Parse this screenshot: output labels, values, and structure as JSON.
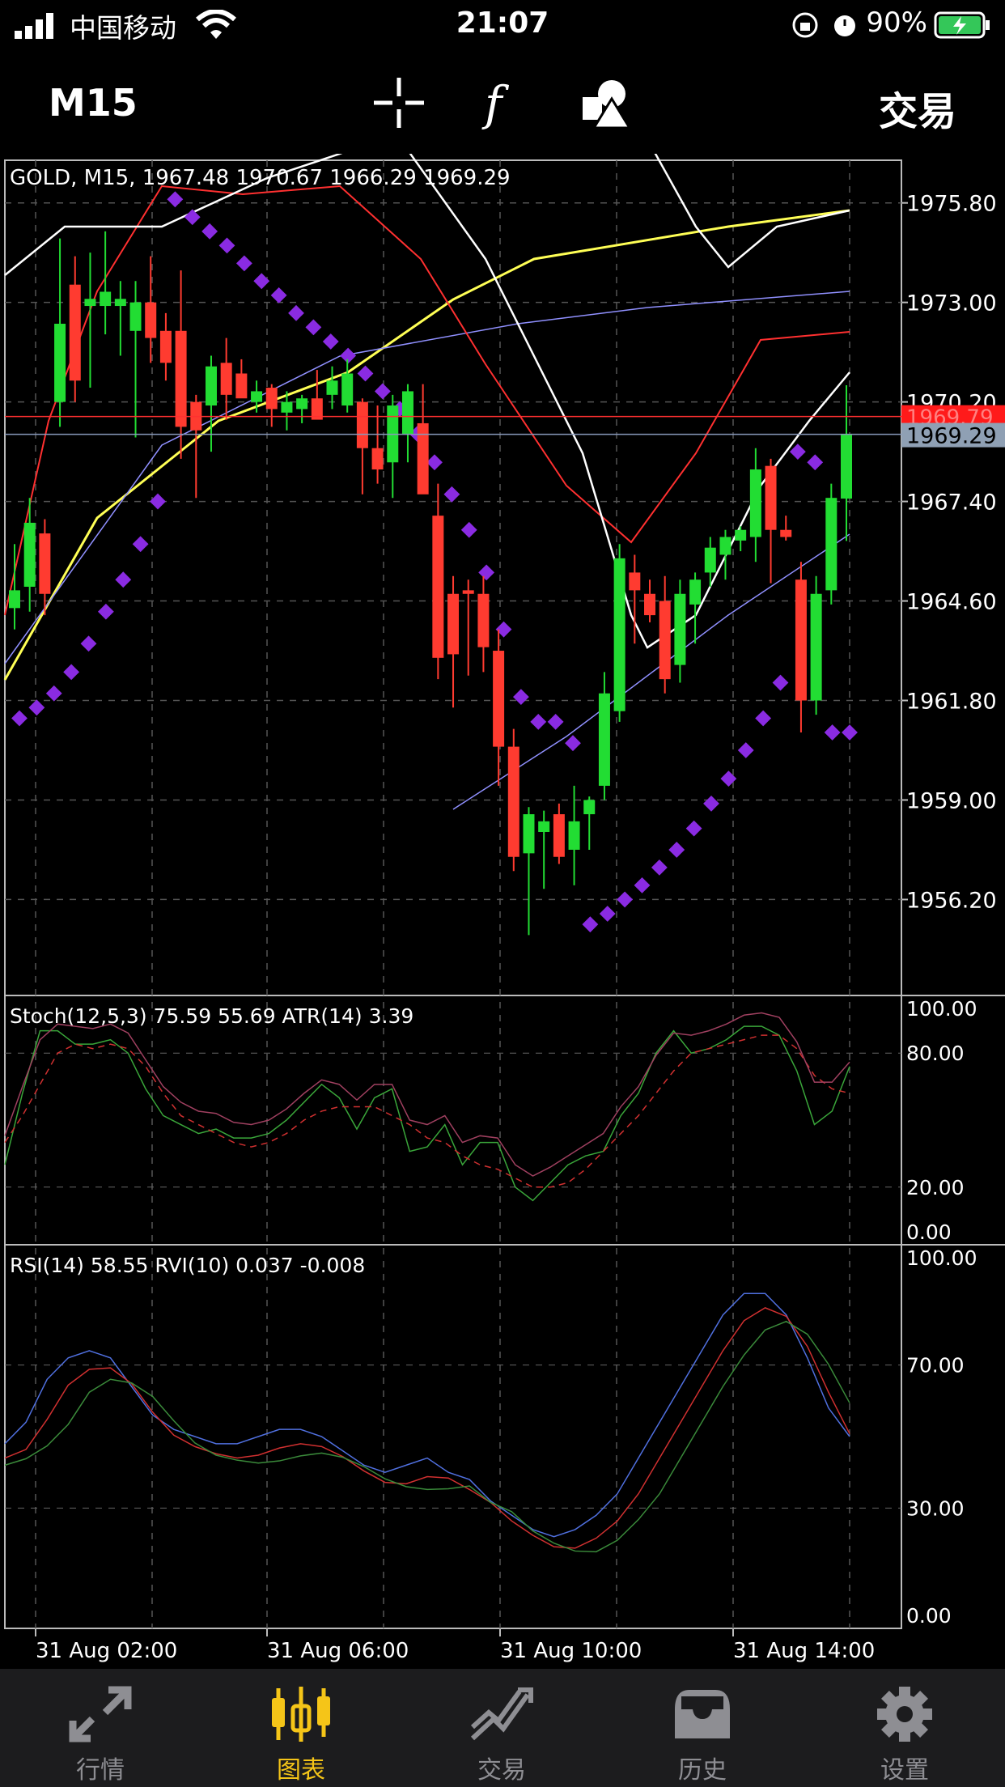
{
  "status_bar": {
    "carrier": "中国移动",
    "time": "21:07",
    "battery_percent": "90%"
  },
  "toolbar": {
    "timeframe": "M15",
    "trade_label": "交易",
    "icons": [
      "crosshair-icon",
      "function-icon",
      "objects-icon"
    ]
  },
  "main_chart": {
    "header": "GOLD, M15, 1967.48 1970.67 1966.29 1969.29",
    "price_axis": [
      "1975.80",
      "1973.00",
      "1970.20",
      "1967.40",
      "1964.60",
      "1961.80",
      "1959.00",
      "1956.20"
    ],
    "price_tags": {
      "ask": "1969.79",
      "bid": "1969.29"
    },
    "colors": {
      "bull": "#22dd33",
      "bear": "#ff3b30",
      "parabolic_sar": "#8a2be2",
      "ma_slow": "#ffff55",
      "ma_blue": "#9090ff"
    }
  },
  "stoch_panel": {
    "header": "Stoch(12,5,3) 75.59 55.69 ATR(14) 3.39",
    "axis": [
      "100.00",
      "80.00",
      "20.00",
      "0.00"
    ]
  },
  "rsi_panel": {
    "header": "RSI(14) 58.55 RVI(10) 0.037 -0.008",
    "axis": [
      "100.00",
      "70.00",
      "30.00",
      "0.00"
    ]
  },
  "time_axis": [
    "31 Aug 02:00",
    "31 Aug 06:00",
    "31 Aug 10:00",
    "31 Aug 14:00"
  ],
  "chart_data": {
    "type": "candlestick",
    "symbol": "GOLD",
    "timeframe": "M15",
    "ohlc_last": {
      "open": 1967.48,
      "high": 1970.67,
      "low": 1966.29,
      "close": 1969.29
    },
    "candles": [
      {
        "o": 1964.4,
        "h": 1966.2,
        "l": 1963.8,
        "c": 1964.9
      },
      {
        "o": 1965.0,
        "h": 1967.5,
        "l": 1964.3,
        "c": 1966.8
      },
      {
        "o": 1966.5,
        "h": 1966.9,
        "l": 1964.2,
        "c": 1964.8
      },
      {
        "o": 1970.2,
        "h": 1974.8,
        "l": 1969.5,
        "c": 1972.4
      },
      {
        "o": 1973.5,
        "h": 1974.3,
        "l": 1970.2,
        "c": 1970.8
      },
      {
        "o": 1972.9,
        "h": 1974.4,
        "l": 1970.6,
        "c": 1973.1
      },
      {
        "o": 1972.9,
        "h": 1975.0,
        "l": 1972.1,
        "c": 1973.3
      },
      {
        "o": 1972.9,
        "h": 1973.6,
        "l": 1971.5,
        "c": 1973.1
      },
      {
        "o": 1972.2,
        "h": 1973.6,
        "l": 1969.2,
        "c": 1973.0
      },
      {
        "o": 1973.0,
        "h": 1974.3,
        "l": 1971.3,
        "c": 1972.0
      },
      {
        "o": 1972.2,
        "h": 1972.7,
        "l": 1970.8,
        "c": 1971.3
      },
      {
        "o": 1972.2,
        "h": 1973.9,
        "l": 1968.6,
        "c": 1969.5
      },
      {
        "o": 1970.2,
        "h": 1970.4,
        "l": 1967.5,
        "c": 1969.4
      },
      {
        "o": 1970.1,
        "h": 1971.5,
        "l": 1968.8,
        "c": 1971.2
      },
      {
        "o": 1971.3,
        "h": 1972.0,
        "l": 1969.7,
        "c": 1970.4
      },
      {
        "o": 1971.0,
        "h": 1971.4,
        "l": 1970.4,
        "c": 1970.3
      },
      {
        "o": 1970.2,
        "h": 1970.8,
        "l": 1969.9,
        "c": 1970.5
      },
      {
        "o": 1970.6,
        "h": 1970.7,
        "l": 1969.5,
        "c": 1970.0
      },
      {
        "o": 1969.9,
        "h": 1970.5,
        "l": 1969.4,
        "c": 1970.2
      },
      {
        "o": 1970.0,
        "h": 1970.4,
        "l": 1969.6,
        "c": 1970.3
      },
      {
        "o": 1970.3,
        "h": 1971.1,
        "l": 1969.8,
        "c": 1969.7
      },
      {
        "o": 1970.4,
        "h": 1971.2,
        "l": 1970.0,
        "c": 1970.8
      },
      {
        "o": 1970.1,
        "h": 1971.4,
        "l": 1969.9,
        "c": 1971.0
      },
      {
        "o": 1970.2,
        "h": 1970.3,
        "l": 1967.6,
        "c": 1968.9
      },
      {
        "o": 1968.9,
        "h": 1970.1,
        "l": 1967.9,
        "c": 1968.3
      },
      {
        "o": 1968.5,
        "h": 1970.4,
        "l": 1967.5,
        "c": 1970.1
      },
      {
        "o": 1969.3,
        "h": 1970.7,
        "l": 1968.5,
        "c": 1970.5
      },
      {
        "o": 1969.6,
        "h": 1970.7,
        "l": 1967.8,
        "c": 1967.6
      },
      {
        "o": 1967.0,
        "h": 1967.9,
        "l": 1962.4,
        "c": 1963.0
      },
      {
        "o": 1964.8,
        "h": 1965.3,
        "l": 1961.6,
        "c": 1963.1
      },
      {
        "o": 1964.9,
        "h": 1965.2,
        "l": 1962.5,
        "c": 1964.8
      },
      {
        "o": 1964.8,
        "h": 1965.3,
        "l": 1962.6,
        "c": 1963.3
      },
      {
        "o": 1963.2,
        "h": 1963.8,
        "l": 1959.4,
        "c": 1960.5
      },
      {
        "o": 1960.5,
        "h": 1961.0,
        "l": 1957.0,
        "c": 1957.4
      },
      {
        "o": 1957.5,
        "h": 1958.8,
        "l": 1955.2,
        "c": 1958.6
      },
      {
        "o": 1958.1,
        "h": 1958.7,
        "l": 1956.5,
        "c": 1958.4
      },
      {
        "o": 1958.6,
        "h": 1958.9,
        "l": 1957.2,
        "c": 1957.4
      },
      {
        "o": 1957.6,
        "h": 1959.4,
        "l": 1956.6,
        "c": 1958.4
      },
      {
        "o": 1958.6,
        "h": 1959.1,
        "l": 1957.6,
        "c": 1959.0
      },
      {
        "o": 1959.4,
        "h": 1962.6,
        "l": 1959.0,
        "c": 1962.0
      },
      {
        "o": 1961.5,
        "h": 1966.2,
        "l": 1961.2,
        "c": 1965.8
      },
      {
        "o": 1965.4,
        "h": 1965.9,
        "l": 1963.4,
        "c": 1964.9
      },
      {
        "o": 1964.8,
        "h": 1965.2,
        "l": 1964.0,
        "c": 1964.2
      },
      {
        "o": 1964.6,
        "h": 1965.3,
        "l": 1962.0,
        "c": 1962.4
      },
      {
        "o": 1962.8,
        "h": 1965.2,
        "l": 1962.3,
        "c": 1964.8
      },
      {
        "o": 1964.5,
        "h": 1965.4,
        "l": 1963.4,
        "c": 1965.2
      },
      {
        "o": 1965.4,
        "h": 1966.4,
        "l": 1965.0,
        "c": 1966.1
      },
      {
        "o": 1965.9,
        "h": 1966.6,
        "l": 1965.2,
        "c": 1966.4
      },
      {
        "o": 1966.3,
        "h": 1966.7,
        "l": 1966.0,
        "c": 1966.6
      },
      {
        "o": 1966.4,
        "h": 1968.9,
        "l": 1965.7,
        "c": 1968.3
      },
      {
        "o": 1968.4,
        "h": 1968.6,
        "l": 1965.1,
        "c": 1966.6
      },
      {
        "o": 1966.6,
        "h": 1967.0,
        "l": 1966.3,
        "c": 1966.4
      },
      {
        "o": 1965.2,
        "h": 1965.7,
        "l": 1960.9,
        "c": 1961.8
      },
      {
        "o": 1961.8,
        "h": 1965.3,
        "l": 1961.4,
        "c": 1964.8
      },
      {
        "o": 1964.9,
        "h": 1967.9,
        "l": 1964.5,
        "c": 1967.5
      },
      {
        "o": 1967.48,
        "h": 1970.67,
        "l": 1966.29,
        "c": 1969.29
      }
    ],
    "parabolic_sar": [
      1961.3,
      1961.6,
      1962.0,
      1962.6,
      1963.4,
      1964.3,
      1965.2,
      1966.2,
      1967.4,
      1975.9,
      1975.4,
      1975.0,
      1974.6,
      1974.1,
      1973.6,
      1973.2,
      1972.7,
      1972.3,
      1971.9,
      1971.5,
      1971.0,
      1970.5,
      1970.0,
      1969.3,
      1968.5,
      1967.6,
      1966.6,
      1965.4,
      1963.8,
      1961.9,
      1961.2,
      1961.2,
      1960.6,
      1955.5,
      1955.8,
      1956.2,
      1956.6,
      1957.1,
      1957.6,
      1958.2,
      1958.9,
      1959.6,
      1960.4,
      1961.3,
      1962.3,
      1968.8,
      1968.5,
      1960.9,
      1960.9
    ],
    "stoch_main": [
      30,
      62,
      90,
      90,
      84,
      84,
      86,
      80,
      64,
      52,
      48,
      44,
      46,
      42,
      42,
      44,
      50,
      58,
      66,
      60,
      46,
      60,
      64,
      36,
      38,
      48,
      30,
      40,
      40,
      20,
      14,
      22,
      30,
      34,
      36,
      52,
      62,
      80,
      90,
      80,
      82,
      86,
      92,
      92,
      88,
      72,
      48,
      54,
      74
    ],
    "stoch_signal": [
      40,
      52,
      66,
      80,
      84,
      82,
      84,
      82,
      74,
      62,
      52,
      48,
      44,
      40,
      38,
      40,
      44,
      50,
      54,
      56,
      56,
      56,
      52,
      48,
      42,
      40,
      34,
      30,
      28,
      24,
      20,
      20,
      22,
      28,
      36,
      44,
      52,
      62,
      72,
      80,
      82,
      84,
      86,
      88,
      88,
      82,
      70,
      64,
      62
    ],
    "rsi": [
      48,
      54,
      66,
      72,
      74,
      72,
      64,
      56,
      52,
      50,
      48,
      48,
      50,
      52,
      52,
      50,
      46,
      42,
      40,
      42,
      44,
      40,
      38,
      32,
      28,
      24,
      22,
      24,
      28,
      34,
      44,
      54,
      64,
      74,
      84,
      90,
      90,
      84,
      72,
      58,
      50
    ]
  }
}
